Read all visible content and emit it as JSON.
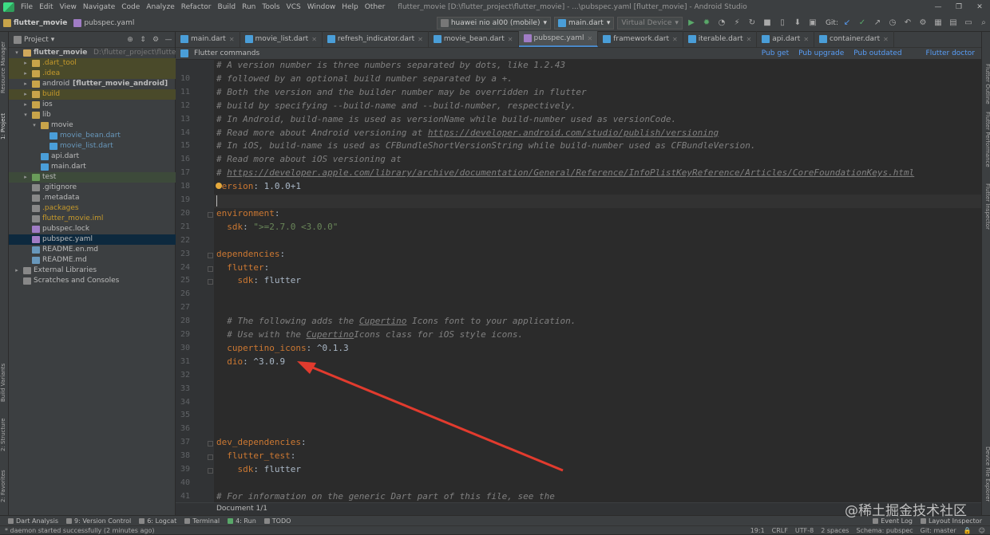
{
  "menu": {
    "items": [
      "File",
      "Edit",
      "View",
      "Navigate",
      "Code",
      "Analyze",
      "Refactor",
      "Build",
      "Run",
      "Tools",
      "VCS",
      "Window",
      "Help",
      "Other"
    ],
    "title": "flutter_movie [D:\\flutter_project\\flutter_movie] - ...\\pubspec.yaml [flutter_movie] - Android Studio",
    "win_min": "—",
    "win_max": "❐",
    "win_close": "✕"
  },
  "nav": {
    "project": "flutter_movie",
    "file": "pubspec.yaml",
    "device": "huawei nio al00 (mobile)",
    "run_config": "main.dart",
    "virtual_device": "Virtual Device",
    "git": "Git:"
  },
  "project_panel": {
    "title": "Project",
    "tree": [
      {
        "label": "flutter_movie",
        "note": "D:\\flutter_project\\flutter_movie",
        "depth": 0,
        "arrow": "▾",
        "bold": true,
        "color": "#bbbbbb",
        "icon": "#d0a85c"
      },
      {
        "label": ".dart_tool",
        "depth": 1,
        "arrow": "▸",
        "color": "#c79a2b",
        "icon": "#c8a44a",
        "hl": "excl"
      },
      {
        "label": ".idea",
        "depth": 1,
        "arrow": "▸",
        "color": "#c79a2b",
        "icon": "#c8a44a",
        "hl": "excl"
      },
      {
        "label": "android",
        "note2": "[flutter_movie_android]",
        "depth": 1,
        "arrow": "▸",
        "color": "#bbbbbb",
        "icon": "#c8a44a",
        "bold2": true
      },
      {
        "label": "build",
        "depth": 1,
        "arrow": "▸",
        "color": "#c79a2b",
        "icon": "#c8a44a",
        "hl": "excl"
      },
      {
        "label": "ios",
        "depth": 1,
        "arrow": "▸",
        "color": "#bbbbbb",
        "icon": "#c8a44a"
      },
      {
        "label": "lib",
        "depth": 1,
        "arrow": "▾",
        "color": "#bbbbbb",
        "icon": "#c8a44a"
      },
      {
        "label": "movie",
        "depth": 2,
        "arrow": "▾",
        "color": "#bbbbbb",
        "icon": "#c8a44a"
      },
      {
        "label": "movie_bean.dart",
        "depth": 3,
        "color": "#6897bb",
        "icon": "#4a9ed8"
      },
      {
        "label": "movie_list.dart",
        "depth": 3,
        "color": "#6897bb",
        "icon": "#4a9ed8"
      },
      {
        "label": "api.dart",
        "depth": 2,
        "color": "#bbbbbb",
        "icon": "#4a9ed8"
      },
      {
        "label": "main.dart",
        "depth": 2,
        "color": "#bbbbbb",
        "icon": "#4a9ed8"
      },
      {
        "label": "test",
        "depth": 1,
        "arrow": "▸",
        "color": "#bbbbbb",
        "icon": "#6a9c5a",
        "hl": "excl2"
      },
      {
        "label": ".gitignore",
        "depth": 1,
        "color": "#bbbbbb",
        "icon": "#888888"
      },
      {
        "label": ".metadata",
        "depth": 1,
        "color": "#bbbbbb",
        "icon": "#888888"
      },
      {
        "label": ".packages",
        "depth": 1,
        "color": "#c79a2b",
        "icon": "#888888"
      },
      {
        "label": "flutter_movie.iml",
        "depth": 1,
        "color": "#c79a2b",
        "icon": "#888888"
      },
      {
        "label": "pubspec.lock",
        "depth": 1,
        "color": "#bbbbbb",
        "icon": "#a07cc5"
      },
      {
        "label": "pubspec.yaml",
        "depth": 1,
        "color": "#bbbbbb",
        "icon": "#a07cc5",
        "hl": "sel"
      },
      {
        "label": "README.en.md",
        "depth": 1,
        "color": "#bbbbbb",
        "icon": "#6897bb"
      },
      {
        "label": "README.md",
        "depth": 1,
        "color": "#bbbbbb",
        "icon": "#6897bb"
      },
      {
        "label": "External Libraries",
        "depth": 0,
        "arrow": "▸",
        "color": "#bbbbbb",
        "icon": "#888888"
      },
      {
        "label": "Scratches and Consoles",
        "depth": 0,
        "color": "#bbbbbb",
        "icon": "#888888"
      }
    ]
  },
  "tabs": [
    {
      "label": "main.dart"
    },
    {
      "label": "movie_list.dart"
    },
    {
      "label": "refresh_indicator.dart"
    },
    {
      "label": "movie_bean.dart"
    },
    {
      "label": "pubspec.yaml",
      "active": true
    },
    {
      "label": "framework.dart"
    },
    {
      "label": "iterable.dart"
    },
    {
      "label": "api.dart"
    },
    {
      "label": "container.dart"
    }
  ],
  "flutter_commands": {
    "label": "Flutter commands",
    "links": [
      "Pub get",
      "Pub upgrade",
      "Pub outdated",
      "Flutter doctor"
    ]
  },
  "editor": {
    "lines": [
      {
        "n": "",
        "segs": [
          [
            "cm",
            "# A version number is three numbers separated by dots, like 1.2.43"
          ]
        ]
      },
      {
        "n": "10",
        "segs": [
          [
            "cm",
            "# followed by an optional build number separated by a +."
          ]
        ]
      },
      {
        "n": "11",
        "segs": [
          [
            "cm",
            "# Both the version and the builder number may be overridden in flutter"
          ]
        ]
      },
      {
        "n": "12",
        "segs": [
          [
            "cm",
            "# build by specifying --build-name and --build-number, respectively."
          ]
        ]
      },
      {
        "n": "13",
        "segs": [
          [
            "cm",
            "# In Android, build-name is used as versionName while build-number used as versionCode."
          ]
        ]
      },
      {
        "n": "14",
        "segs": [
          [
            "cm",
            "# Read more about Android versioning at "
          ],
          [
            "cmu",
            "https://developer.android.com/studio/publish/versioning"
          ]
        ]
      },
      {
        "n": "15",
        "segs": [
          [
            "cm",
            "# In iOS, build-name is used as CFBundleShortVersionString while build-number used as CFBundleVersion."
          ]
        ]
      },
      {
        "n": "16",
        "segs": [
          [
            "cm",
            "# Read more about iOS versioning at"
          ]
        ]
      },
      {
        "n": "17",
        "segs": [
          [
            "cm",
            "# "
          ],
          [
            "cmu",
            "https://developer.apple.com/library/archive/documentation/General/Reference/InfoPlistKeyReference/Articles/CoreFoundationKeys.html"
          ]
        ]
      },
      {
        "n": "18",
        "segs": [
          [
            "ky",
            "version"
          ],
          [
            "tx",
            ": 1.0.0+1"
          ]
        ]
      },
      {
        "n": "19",
        "segs": []
      },
      {
        "n": "20",
        "segs": [
          [
            "ky",
            "environment"
          ],
          [
            "tx",
            ":"
          ]
        ]
      },
      {
        "n": "21",
        "segs": [
          [
            "tx",
            "  "
          ],
          [
            "ky",
            "sdk"
          ],
          [
            "tx",
            ": "
          ],
          [
            "st",
            "\">=2.7.0 <3.0.0\""
          ]
        ]
      },
      {
        "n": "22",
        "segs": []
      },
      {
        "n": "23",
        "segs": [
          [
            "ky",
            "dependencies"
          ],
          [
            "tx",
            ":"
          ]
        ]
      },
      {
        "n": "24",
        "segs": [
          [
            "tx",
            "  "
          ],
          [
            "ky",
            "flutter"
          ],
          [
            "tx",
            ":"
          ]
        ]
      },
      {
        "n": "25",
        "segs": [
          [
            "tx",
            "    "
          ],
          [
            "ky",
            "sdk"
          ],
          [
            "tx",
            ": flutter"
          ]
        ]
      },
      {
        "n": "26",
        "segs": []
      },
      {
        "n": "27",
        "segs": []
      },
      {
        "n": "28",
        "segs": [
          [
            "tx",
            "  "
          ],
          [
            "cm",
            "# The following adds the "
          ],
          [
            "cmu",
            "Cupertino"
          ],
          [
            "cm",
            " Icons font to your application."
          ]
        ]
      },
      {
        "n": "29",
        "segs": [
          [
            "tx",
            "  "
          ],
          [
            "cm",
            "# Use with the "
          ],
          [
            "cmu",
            "Cupertino"
          ],
          [
            "cm",
            "Icons class for iOS style icons."
          ]
        ]
      },
      {
        "n": "30",
        "segs": [
          [
            "tx",
            "  "
          ],
          [
            "ky",
            "cupertino_icons"
          ],
          [
            "tx",
            ": ^0.1.3"
          ]
        ]
      },
      {
        "n": "31",
        "segs": [
          [
            "tx",
            "  "
          ],
          [
            "ky",
            "dio"
          ],
          [
            "tx",
            ": ^3.0.9"
          ]
        ]
      },
      {
        "n": "32",
        "segs": []
      },
      {
        "n": "33",
        "segs": []
      },
      {
        "n": "34",
        "segs": []
      },
      {
        "n": "35",
        "segs": []
      },
      {
        "n": "36",
        "segs": []
      },
      {
        "n": "37",
        "segs": [
          [
            "ky",
            "dev_dependencies"
          ],
          [
            "tx",
            ":"
          ]
        ]
      },
      {
        "n": "38",
        "segs": [
          [
            "tx",
            "  "
          ],
          [
            "ky",
            "flutter_test"
          ],
          [
            "tx",
            ":"
          ]
        ]
      },
      {
        "n": "39",
        "segs": [
          [
            "tx",
            "    "
          ],
          [
            "ky",
            "sdk"
          ],
          [
            "tx",
            ": flutter"
          ]
        ]
      },
      {
        "n": "40",
        "segs": []
      },
      {
        "n": "41",
        "segs": [
          [
            "cm",
            "# For information on the generic Dart part of this file, see the"
          ]
        ]
      }
    ],
    "doc_label": "Document 1/1"
  },
  "left_strip": [
    "Resource Manager",
    "1: Project",
    "Build Variants",
    "2: Structure",
    "2: Favorites"
  ],
  "right_strip": [
    "Flutter Outline",
    "Flutter Performance",
    "Flutter Inspector",
    "Device File Explorer"
  ],
  "bottom_tools": [
    "Dart Analysis",
    "9: Version Control",
    "6: Logcat",
    "Terminal",
    "4: Run",
    "TODO"
  ],
  "bottom_right": [
    "Event Log",
    "Layout Inspector"
  ],
  "status": {
    "message": "* daemon started successfully (2 minutes ago)",
    "position": "19:1",
    "line_sep": "CRLF",
    "encoding": "UTF-8",
    "indent": "2 spaces",
    "schema": "Schema: pubspec",
    "git": "Git: master"
  },
  "watermark": "@稀土掘金技术社区"
}
